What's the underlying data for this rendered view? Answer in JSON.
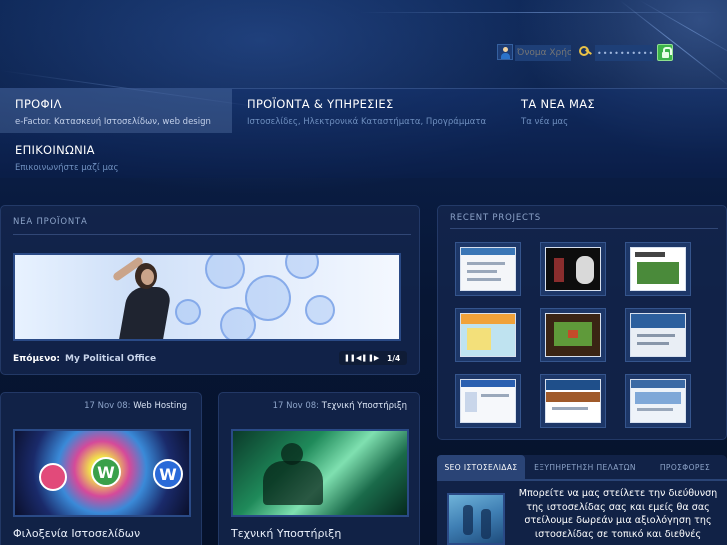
{
  "login": {
    "username_placeholder": "Όνομα Χρήσ",
    "password_mask": "••••••••••••"
  },
  "nav": {
    "items": [
      {
        "title": "ΠΡΟΦΙΛ",
        "subtitle": "e-Factor. Κατασκευή Ιστοσελίδων, web design"
      },
      {
        "title": "ΠΡΟΪΟΝΤΑ & ΥΠΗΡΕΣΙΕΣ",
        "subtitle": "Ιστοσελίδες, Ηλεκτρονικά Καταστήματα, Προγράμματα"
      },
      {
        "title": "ΤΑ ΝΕΑ ΜΑΣ",
        "subtitle": "Τα νέα μας"
      },
      {
        "title": "ΕΠΙΚΟΙΝΩΝΙΑ",
        "subtitle": "Επικοινωνήστε μαζί μας"
      }
    ]
  },
  "new_products": {
    "title": "ΝΕΑ ΠΡΟΪΟΝΤΑ",
    "next_label": "Επόμενο:",
    "next_value": "My Political Office",
    "counter": "1/4"
  },
  "recent_projects": {
    "title": "RECENT PROJECTS"
  },
  "news": [
    {
      "date": "17 Nov 08:",
      "category": "Web Hosting",
      "title": "Φιλοξενία Ιστοσελίδων"
    },
    {
      "date": "17 Nov 08:",
      "category": "Τεχνική Υποστήριξη",
      "title": "Τεχνική Υποστήριξη"
    }
  ],
  "tabs": {
    "items": [
      "SEO ΙΣΤΟΣΕΛΙΔΑΣ",
      "ΕΞΥΠΗΡΕΤΗΣΗ ΠΕΛΑΤΩΝ",
      "ΠΡΟΣΦΟΡΕΣ"
    ],
    "active_text": "Μπορείτε να μας στείλετε την διεύθυνση της ιστοσελίδας σας και εμείς θα σας στείλουμε δωρεάν μια αξιολόγηση της ιστοσελίδας σε τοπικό και διεθνές"
  },
  "colors": {
    "background": "#07142e",
    "panel": "#14264e",
    "accent_green": "#3db34a",
    "nav_active": "#7896c8"
  }
}
